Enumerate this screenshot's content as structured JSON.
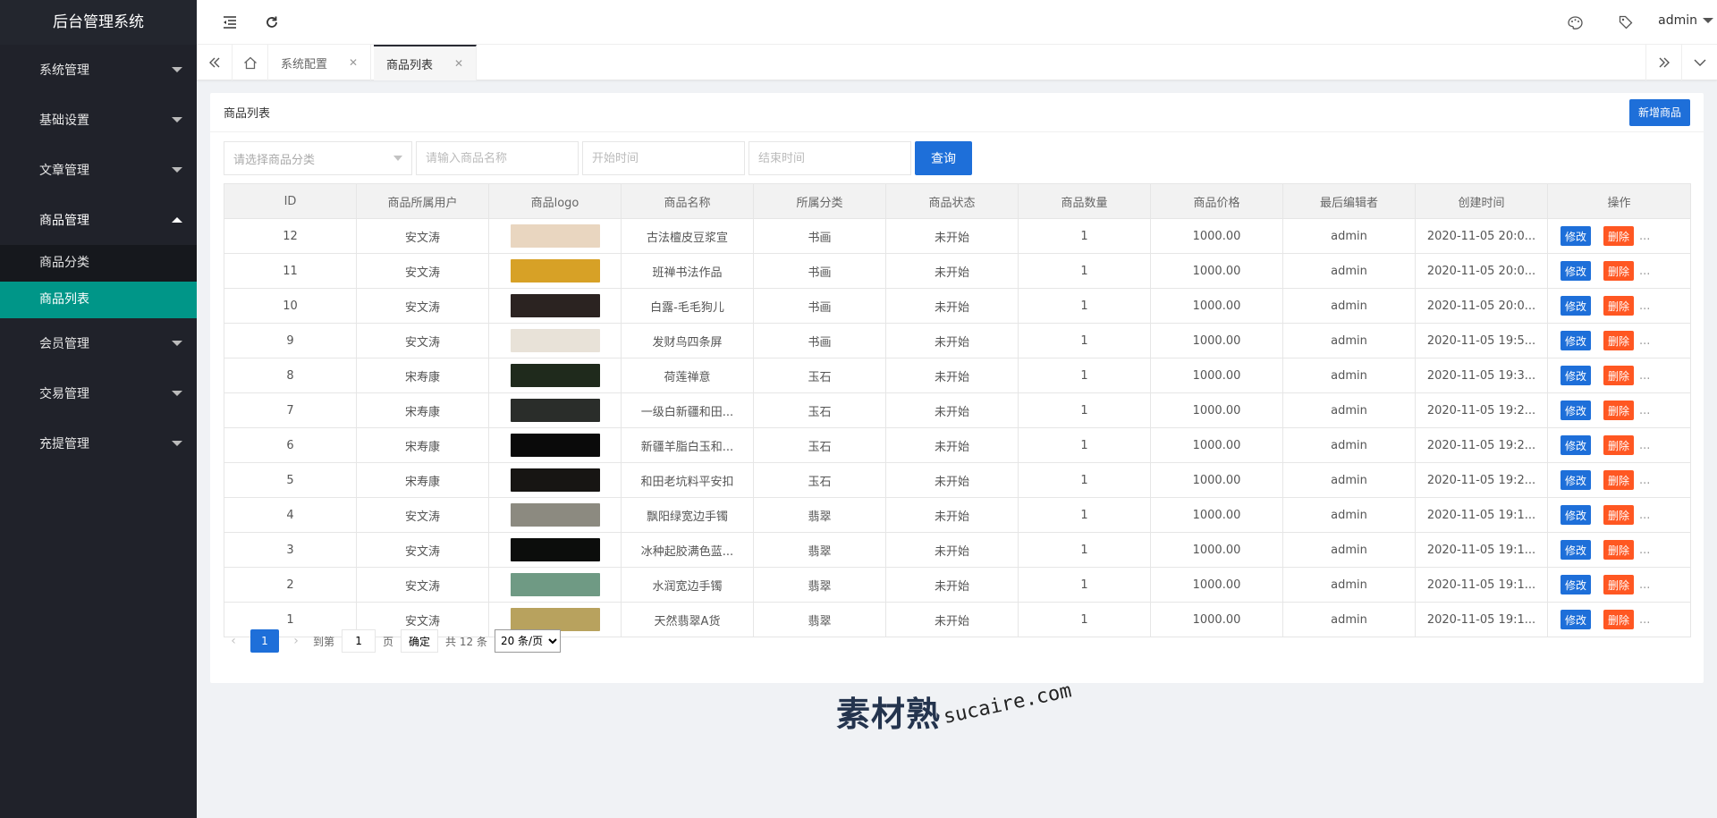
{
  "app": {
    "title": "后台管理系统"
  },
  "sidebar": {
    "items": [
      {
        "label": "系统管理"
      },
      {
        "label": "基础设置"
      },
      {
        "label": "文章管理"
      },
      {
        "label": "商品管理",
        "children": [
          {
            "label": "商品分类"
          },
          {
            "label": "商品列表"
          }
        ]
      },
      {
        "label": "会员管理"
      },
      {
        "label": "交易管理"
      },
      {
        "label": "充提管理"
      }
    ],
    "active_accent": "#009688",
    "bg_color": "#20222a"
  },
  "header": {
    "user": "admin",
    "icons": [
      "menu-fold-icon",
      "refresh-icon",
      "palette-icon",
      "tag-icon"
    ]
  },
  "tabs": {
    "items": [
      {
        "label": "系统配置"
      },
      {
        "label": "商品列表"
      }
    ],
    "active": "商品列表"
  },
  "card": {
    "title": "商品列表",
    "add_button": "新增商品"
  },
  "filters": {
    "category_placeholder": "请选择商品分类",
    "name_placeholder": "请输入商品名称",
    "start_placeholder": "开始时间",
    "end_placeholder": "结束时间",
    "query_button": "查询"
  },
  "table": {
    "columns": [
      "ID",
      "商品所属用户",
      "商品logo",
      "商品名称",
      "所属分类",
      "商品状态",
      "商品数量",
      "商品价格",
      "最后编辑者",
      "创建时间",
      "操作"
    ],
    "edit_label": "修改",
    "delete_label": "删除",
    "rows": [
      {
        "id": "12",
        "user": "安文涛",
        "logo_color": "#e9d6c0",
        "name": "古法檀皮豆浆宣",
        "category": "书画",
        "status": "未开始",
        "qty": "1",
        "price": "1000.00",
        "editor": "admin",
        "created": "2020-11-05 20:0..."
      },
      {
        "id": "11",
        "user": "安文涛",
        "logo_color": "#d7a126",
        "name": "班禅书法作品",
        "category": "书画",
        "status": "未开始",
        "qty": "1",
        "price": "1000.00",
        "editor": "admin",
        "created": "2020-11-05 20:0..."
      },
      {
        "id": "10",
        "user": "安文涛",
        "logo_color": "#2b2321",
        "name": "白露-毛毛狗儿",
        "category": "书画",
        "status": "未开始",
        "qty": "1",
        "price": "1000.00",
        "editor": "admin",
        "created": "2020-11-05 20:0..."
      },
      {
        "id": "9",
        "user": "安文涛",
        "logo_color": "#e8e2d8",
        "name": "发财鸟四条屏",
        "category": "书画",
        "status": "未开始",
        "qty": "1",
        "price": "1000.00",
        "editor": "admin",
        "created": "2020-11-05 19:5..."
      },
      {
        "id": "8",
        "user": "宋寿康",
        "logo_color": "#1f2a1c",
        "name": "荷莲禅意",
        "category": "玉石",
        "status": "未开始",
        "qty": "1",
        "price": "1000.00",
        "editor": "admin",
        "created": "2020-11-05 19:3..."
      },
      {
        "id": "7",
        "user": "宋寿康",
        "logo_color": "#2a2d2a",
        "name": "一级白新疆和田...",
        "category": "玉石",
        "status": "未开始",
        "qty": "1",
        "price": "1000.00",
        "editor": "admin",
        "created": "2020-11-05 19:2..."
      },
      {
        "id": "6",
        "user": "宋寿康",
        "logo_color": "#0a0a0a",
        "name": "新疆羊脂白玉和...",
        "category": "玉石",
        "status": "未开始",
        "qty": "1",
        "price": "1000.00",
        "editor": "admin",
        "created": "2020-11-05 19:2..."
      },
      {
        "id": "5",
        "user": "宋寿康",
        "logo_color": "#171513",
        "name": "和田老坑料平安扣",
        "category": "玉石",
        "status": "未开始",
        "qty": "1",
        "price": "1000.00",
        "editor": "admin",
        "created": "2020-11-05 19:2..."
      },
      {
        "id": "4",
        "user": "安文涛",
        "logo_color": "#8c8a80",
        "name": "飘阳绿宽边手镯",
        "category": "翡翠",
        "status": "未开始",
        "qty": "1",
        "price": "1000.00",
        "editor": "admin",
        "created": "2020-11-05 19:1..."
      },
      {
        "id": "3",
        "user": "安文涛",
        "logo_color": "#0c0d0c",
        "name": "冰种起胶满色蓝...",
        "category": "翡翠",
        "status": "未开始",
        "qty": "1",
        "price": "1000.00",
        "editor": "admin",
        "created": "2020-11-05 19:1..."
      },
      {
        "id": "2",
        "user": "安文涛",
        "logo_color": "#6f9a84",
        "name": "水润宽边手镯",
        "category": "翡翠",
        "status": "未开始",
        "qty": "1",
        "price": "1000.00",
        "editor": "admin",
        "created": "2020-11-05 19:1..."
      },
      {
        "id": "1",
        "user": "安文涛",
        "logo_color": "#b8a25e",
        "name": "天然翡翠A货",
        "category": "翡翠",
        "status": "未开始",
        "qty": "1",
        "price": "1000.00",
        "editor": "admin",
        "created": "2020-11-05 19:1..."
      }
    ]
  },
  "pager": {
    "current": "1",
    "goto_label": "到第",
    "goto_value": "1",
    "page_label": "页",
    "confirm": "确定",
    "total": "共 12 条",
    "page_size": "20 条/页"
  },
  "watermark": {
    "cn": "素材熟",
    "en": "sucaire.com"
  }
}
